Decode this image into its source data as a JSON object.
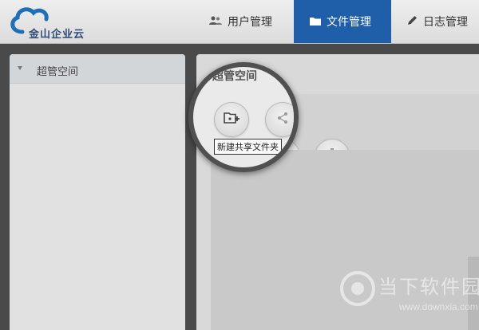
{
  "header": {
    "logo_text": "金山企业云",
    "nav": [
      {
        "label": "用户管理",
        "icon": "users-icon",
        "active": false
      },
      {
        "label": "文件管理",
        "icon": "folder-icon",
        "active": true
      },
      {
        "label": "日志管理",
        "icon": "pencil-icon",
        "active": false
      }
    ]
  },
  "sidebar": {
    "tree_root_label": "超管空间"
  },
  "main": {
    "title": "超管空间",
    "toolbar": {
      "new_folder_tooltip": "新建共享文件夹"
    }
  },
  "watermark": {
    "text": "当下软件园",
    "url": "www.downxia.com"
  },
  "colors": {
    "accent": "#1f5ea8",
    "header_bg": "#e6e6e6",
    "background": "#4a4a4a"
  }
}
